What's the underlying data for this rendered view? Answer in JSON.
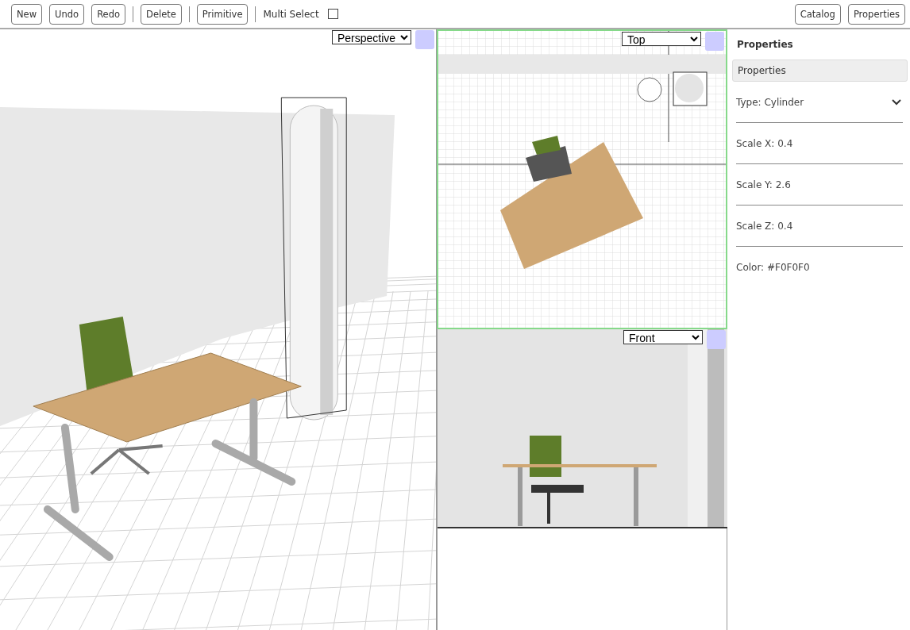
{
  "toolbar": {
    "left": [
      {
        "kind": "button",
        "label": "New"
      },
      {
        "kind": "button",
        "label": "Undo"
      },
      {
        "kind": "button",
        "label": "Redo"
      },
      {
        "kind": "separator"
      },
      {
        "kind": "button",
        "label": "Delete"
      },
      {
        "kind": "separator"
      },
      {
        "kind": "button",
        "label": "Primitive"
      },
      {
        "kind": "separator"
      },
      {
        "kind": "checkbox",
        "label": "Multi Select",
        "checked": false
      }
    ],
    "right": [
      {
        "kind": "button",
        "label": "Catalog"
      },
      {
        "kind": "button",
        "label": "Properties"
      }
    ]
  },
  "viewports": [
    {
      "kind": "perspective",
      "view": "Perspective",
      "selected": false
    },
    {
      "kind": "top",
      "view": "Top",
      "selected": true
    },
    {
      "kind": "front",
      "view": "Front",
      "selected": false
    }
  ],
  "properties": {
    "heading": "Properties",
    "section": "Properties",
    "fields": [
      {
        "kind": "dropdown",
        "text": "Type: Cylinder"
      },
      {
        "kind": "text",
        "text": "Scale X: 0.4"
      },
      {
        "kind": "text",
        "text": "Scale Y: 2.6"
      },
      {
        "kind": "text",
        "text": "Scale Z: 0.4"
      },
      {
        "kind": "text",
        "text": "Color: #F0F0F0"
      }
    ]
  }
}
